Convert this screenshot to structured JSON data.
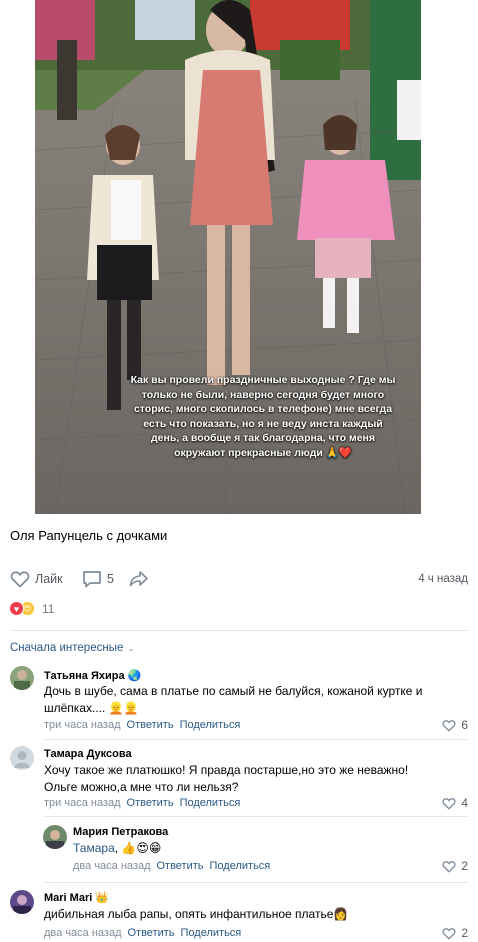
{
  "post": {
    "overlay_text": "Как вы провели праздничные выходные ? Где мы\nтолько не были, наверно сегодня будет много\nсторис, много скопилось в телефоне) мне всегда\nесть что показать, но я не веду инста каждый\nдень, а вообще я так благодарна, что меня\nокружают прекрасные люди 🙏❤️",
    "caption": "Оля Рапунцель с дочками",
    "like_label": "Лайк",
    "comments_count": "5",
    "time_ago": "4 ч назад",
    "reactions_count": "11"
  },
  "sort_label": "Сначала интересные",
  "comments": [
    {
      "name": "Татьяна Яхира",
      "badge": "🌏",
      "text": "Дочь в шубе, сама в платье по самый не балуйся, кожаной куртке и шлёпках.... 👱👱",
      "time": "три часа назад",
      "reply": "Ответить",
      "share": "Поделиться",
      "likes": "6"
    },
    {
      "name": "Тамара Дуксова",
      "badge": "",
      "text": "Хочу такое же платюшко! Я правда постарше,но это же неважно! Ольге можно,а мне что ли нельзя?",
      "time": "три часа назад",
      "reply": "Ответить",
      "share": "Поделиться",
      "likes": "4"
    },
    {
      "name": "Мария Петракова",
      "badge": "",
      "mention": "Тамара",
      "text": ", 👍😍😁",
      "time": "два часа назад",
      "reply": "Ответить",
      "share": "Поделиться",
      "likes": "2"
    },
    {
      "name": "Mari Mari",
      "badge": "👑",
      "text": "дибильная лыба рапы, опять инфантильное платье👩",
      "time": "два часа назад",
      "reply": "Ответить",
      "share": "Поделиться",
      "likes": "2"
    }
  ],
  "colors": {
    "link": "#2a5885",
    "meta": "#818c99",
    "heart": "#f0394a"
  }
}
